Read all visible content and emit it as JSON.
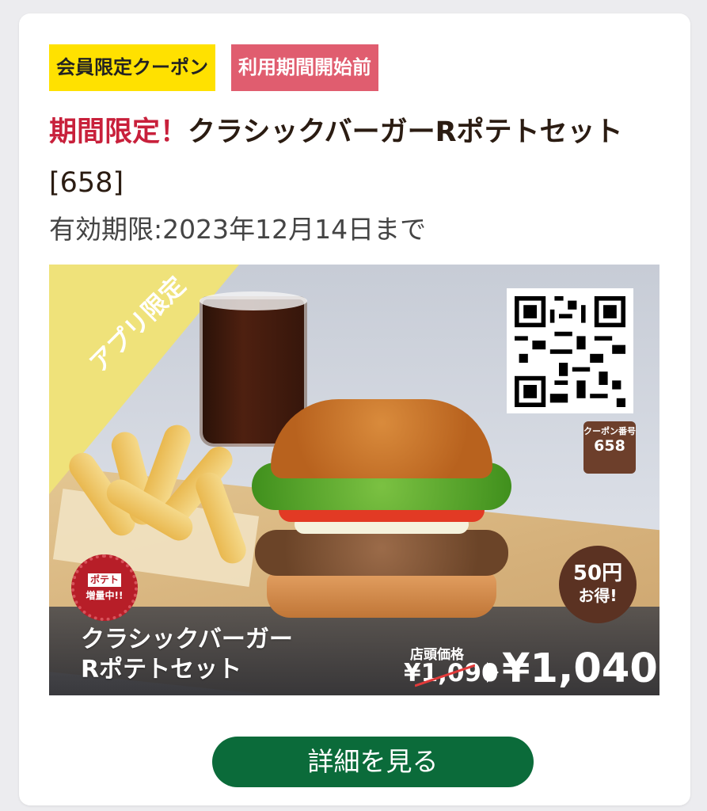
{
  "badges": {
    "member": "会員限定クーポン",
    "status": "利用期間開始前"
  },
  "title": {
    "accent": "期間限定！",
    "main": "クラシックバーガーRポテトセット",
    "code": "[658]"
  },
  "expiry": "有効期限:2023年12月14日まで",
  "banner": {
    "corner_text": "アプリ限定",
    "coupon_number_label": "クーポン番号",
    "coupon_number": "658",
    "savings_line1": "50円",
    "savings_line2": "お得!",
    "potato_badge_line1": "ポテト",
    "potato_badge_line2": "増量中!!",
    "product_line1": "クラシックバーガー",
    "product_line2": "Rポテトセット",
    "price_label": "店頭価格",
    "price_old": "¥1,090",
    "price_new": "¥1,040"
  },
  "detail_button": "詳細を見る",
  "colors": {
    "badge_member": "#ffe100",
    "badge_status": "#e05d6f",
    "accent_red": "#c8203b",
    "button_green": "#0b6b3a",
    "brown": "#6d3f2b"
  }
}
